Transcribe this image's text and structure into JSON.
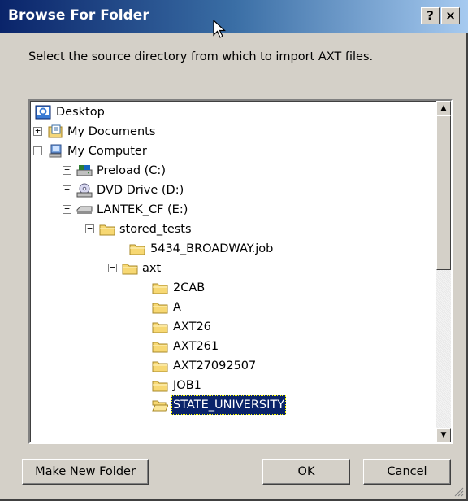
{
  "window": {
    "title": "Browse For Folder",
    "help_label": "?",
    "close_label": "×"
  },
  "prompt": "Select the source directory from which to import AXT files.",
  "tree": {
    "items": [
      {
        "label": "Desktop",
        "icon": "desktop-icon"
      },
      {
        "label": "My Documents",
        "icon": "my-documents-icon",
        "expander": "+"
      },
      {
        "label": "My Computer",
        "icon": "my-computer-icon",
        "expander": "−"
      },
      {
        "label": "Preload (C:)",
        "icon": "hard-drive-icon",
        "expander": "+"
      },
      {
        "label": "DVD Drive (D:)",
        "icon": "dvd-drive-icon",
        "expander": "+"
      },
      {
        "label": "LANTEK_CF (E:)",
        "icon": "removable-drive-icon",
        "expander": "−"
      },
      {
        "label": "stored_tests",
        "icon": "folder-icon",
        "expander": "−"
      },
      {
        "label": "5434_BROADWAY.job",
        "icon": "folder-icon"
      },
      {
        "label": "axt",
        "icon": "folder-icon",
        "expander": "−"
      },
      {
        "label": "2CAB",
        "icon": "folder-icon"
      },
      {
        "label": "A",
        "icon": "folder-icon"
      },
      {
        "label": "AXT26",
        "icon": "folder-icon"
      },
      {
        "label": "AXT261",
        "icon": "folder-icon"
      },
      {
        "label": "AXT27092507",
        "icon": "folder-icon"
      },
      {
        "label": "JOB1",
        "icon": "folder-icon"
      },
      {
        "label": "STATE_UNIVERSITY",
        "icon": "folder-icon",
        "selected": true
      }
    ]
  },
  "buttons": {
    "make_new_folder": "Make New Folder",
    "ok": "OK",
    "cancel": "Cancel"
  },
  "scrollbar": {
    "up": "▲",
    "down": "▼"
  }
}
